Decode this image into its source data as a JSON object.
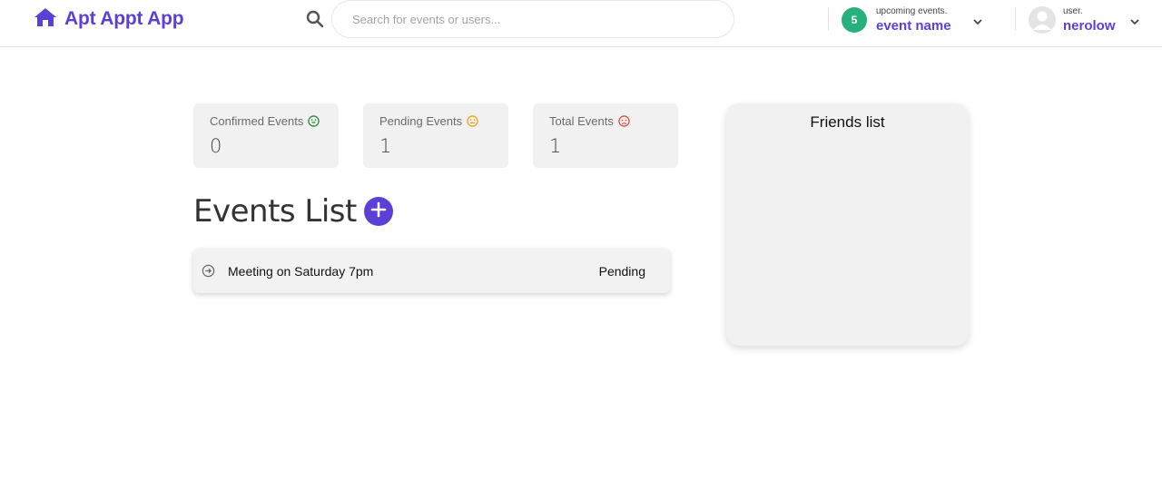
{
  "brand": {
    "name": "Apt Appt App",
    "icon": "home-icon",
    "color": "#5b3fd6"
  },
  "search": {
    "placeholder": "Search for events or users..."
  },
  "upcoming": {
    "count": "5",
    "caption": "upcoming events.",
    "name": "event name",
    "badge_color": "#26b07e"
  },
  "user": {
    "caption": "user.",
    "name": "nerolow"
  },
  "stats": [
    {
      "label": "Confirmed Events",
      "value": "0",
      "emoji": "grin-green-icon",
      "color": "#2e8b3a"
    },
    {
      "label": "Pending Events",
      "value": "1",
      "emoji": "grin-orange-icon",
      "color": "#f0a020"
    },
    {
      "label": "Total Events",
      "value": "1",
      "emoji": "angry-red-icon",
      "color": "#e0524a"
    }
  ],
  "events": {
    "title": "Events List",
    "items": [
      {
        "name": "Meeting on Saturday 7pm",
        "status": "Pending"
      }
    ]
  },
  "friends": {
    "title": "Friends list"
  }
}
